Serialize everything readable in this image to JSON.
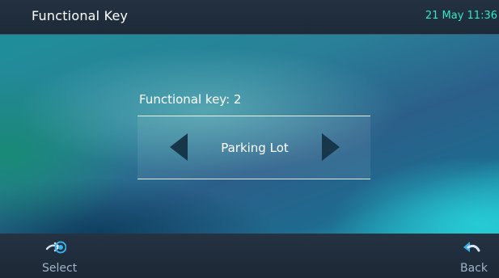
{
  "header": {
    "title": "Functional Key",
    "clock": "21 May 11:36"
  },
  "main": {
    "key_label": "Functional key: 2",
    "selector_value": "Parking Lot"
  },
  "softkeys": {
    "select_label": "Select",
    "select_icon": "forward-arrow-icon",
    "back_label": "Back",
    "back_icon": "back-arrow-icon"
  },
  "colors": {
    "clock": "#2ee8c8",
    "arrow": "#17364a",
    "softkey_text": "#9fb4c6"
  }
}
